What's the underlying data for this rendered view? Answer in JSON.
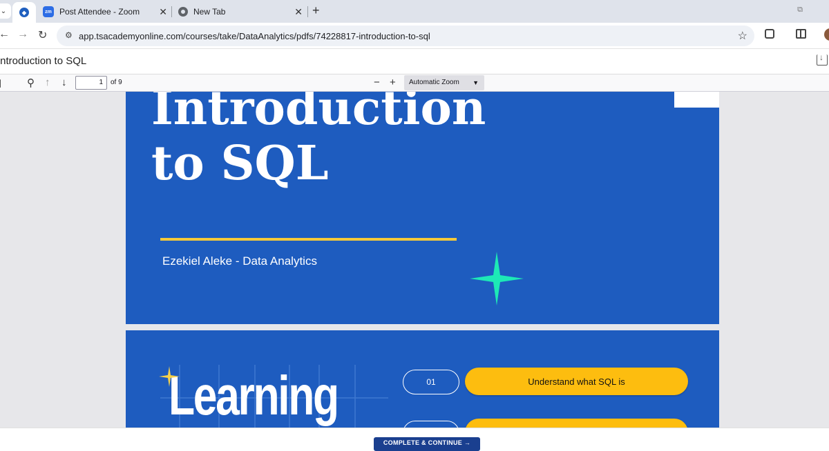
{
  "browser": {
    "tabs": [
      {
        "title": "Post Attendee - Zoom",
        "favicon": "zoom-icon"
      },
      {
        "title": "New Tab",
        "favicon": "chrome-icon"
      }
    ],
    "active_tab_favicon": "site-icon",
    "url": "app.tsacademyonline.com/courses/take/DataAnalytics/pdfs/74228817-introduction-to-sql"
  },
  "document": {
    "title": "Introduction to SQL"
  },
  "pdf_toolbar": {
    "page_number": "1",
    "page_count": "of 9",
    "zoom": "Automatic Zoom"
  },
  "slides": {
    "cover": {
      "title_line1": "Introduction",
      "title_line2": "to SQL",
      "author": "Ezekiel Aleke - Data Analytics",
      "accent_color": "#f5c93a",
      "sparkle_color": "#1de9b6",
      "background": "#1e5cbf"
    },
    "objectives": {
      "heading": "Learning",
      "items": [
        {
          "number": "01",
          "text": "Understand what SQL is"
        },
        {
          "number": "",
          "text": ""
        }
      ],
      "pill_color": "#fdbd0f"
    }
  },
  "footer": {
    "continue_label": "COMPLETE & CONTINUE →"
  }
}
